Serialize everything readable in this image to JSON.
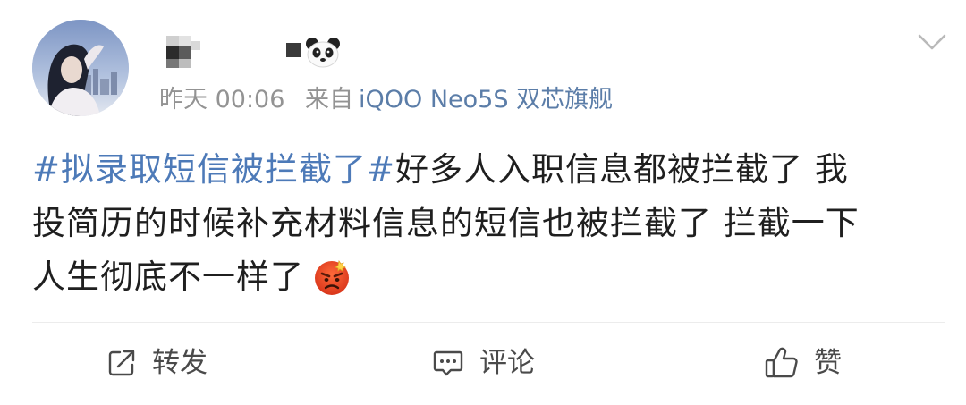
{
  "post": {
    "meta": {
      "time": "昨天 00:06",
      "source_prefix": "来自",
      "source_device": "iQOO Neo5S 双芯旗舰"
    },
    "content": {
      "hashtag": "#拟录取短信被拦截了#",
      "line1_rest": "好多人入职信息都被拦截了 我",
      "line2": "投简历的时候补充材料信息的短信也被拦截了 拦截一下",
      "line3": "人生彻底不一样了"
    },
    "emoji": "angry-face-icon",
    "actions": {
      "repost_label": "转发",
      "comment_label": "评论",
      "like_label": "赞"
    }
  },
  "colors": {
    "hashtag": "#4d7ab8",
    "meta_text": "#939393",
    "source_device": "#5b7da8",
    "body_text": "#1f1f1f",
    "action_text": "#4a4a4a",
    "divider": "#ececec"
  }
}
